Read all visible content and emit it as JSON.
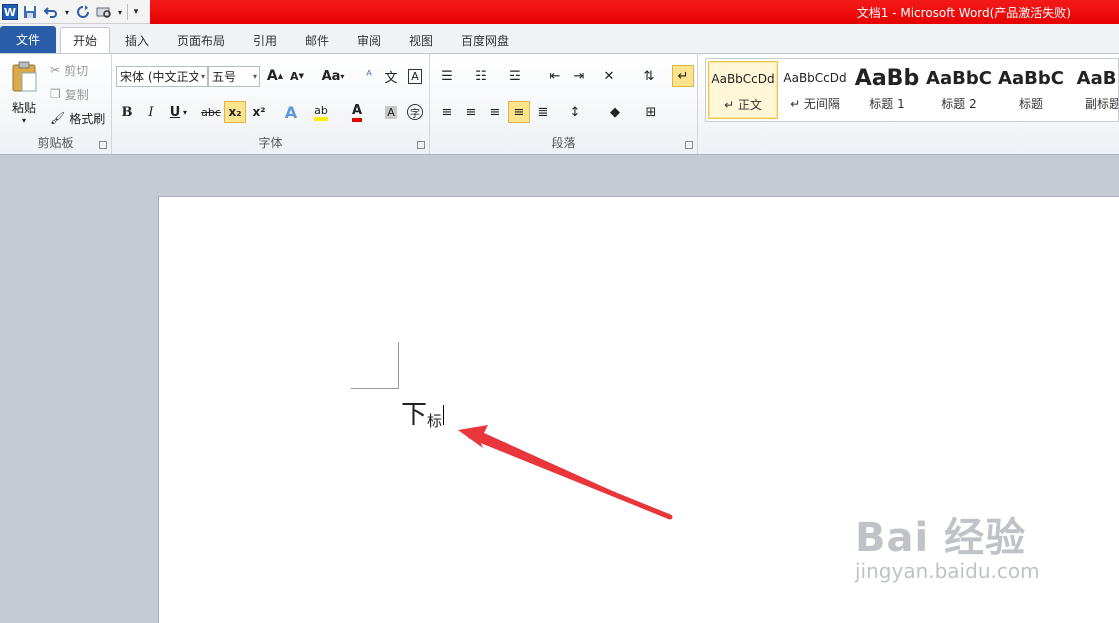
{
  "app": {
    "title": "文档1 - Microsoft Word(产品激活失败)",
    "logo_letter": "W"
  },
  "quick_access": {
    "icons": [
      "save-icon",
      "undo-icon",
      "redo-icon",
      "print-preview-icon",
      "customize-icon"
    ]
  },
  "tabs": [
    {
      "label": "文件"
    },
    {
      "label": "开始"
    },
    {
      "label": "插入"
    },
    {
      "label": "页面布局"
    },
    {
      "label": "引用"
    },
    {
      "label": "邮件"
    },
    {
      "label": "审阅"
    },
    {
      "label": "视图"
    },
    {
      "label": "百度网盘"
    }
  ],
  "clipboard": {
    "paste": "粘贴",
    "cut": "剪切",
    "copy": "复制",
    "format_painter": "格式刷",
    "label": "剪贴板"
  },
  "font": {
    "font_name": "宋体 (中文正文)",
    "font_size": "五号",
    "grow": "A",
    "shrink": "A",
    "change_case": "Aa",
    "bold": "B",
    "italic": "I",
    "underline": "U",
    "strikethrough": "abc",
    "subscript": "x₂",
    "superscript": "x²",
    "label": "字体"
  },
  "paragraph": {
    "label": "段落"
  },
  "styles": [
    {
      "sample": "AaBbCcDd",
      "name": "↵ 正文"
    },
    {
      "sample": "AaBbCcDd",
      "name": "↵ 无间隔"
    },
    {
      "sample": "AaBb",
      "name": "标题 1"
    },
    {
      "sample": "AaBbC",
      "name": "标题 2"
    },
    {
      "sample": "AaBbC",
      "name": "标题"
    },
    {
      "sample": "AaBb",
      "name": "副标题"
    }
  ],
  "document": {
    "char_main": "下",
    "char_sub": "标"
  },
  "watermark": {
    "main": "Bai 经验",
    "sub": "jingyan.baidu.com"
  },
  "colors": {
    "title_bar": "#e60000",
    "file_tab": "#2a5da8",
    "arrow": "#e8363a",
    "active_highlight": "#fde38c"
  }
}
